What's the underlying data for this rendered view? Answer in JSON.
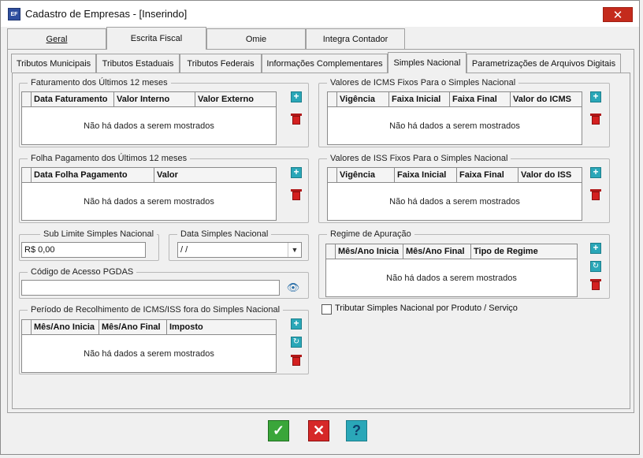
{
  "window": {
    "app_icon": "EF",
    "title": "Cadastro de Empresas - [Inserindo]",
    "close_label": "✕"
  },
  "tabs_main": [
    "Geral",
    "Escrita Fiscal",
    "Omie",
    "Integra Contador"
  ],
  "tabs_main_active": "Escrita Fiscal",
  "tabs_sub": [
    "Tributos Municipais",
    "Tributos Estaduais",
    "Tributos Federais",
    "Informações Complementares",
    "Simples Nacional",
    "Parametrizações de Arquivos Digitais"
  ],
  "tabs_sub_active": "Simples Nacional",
  "empty_grid_text": "Não há dados a serem mostrados",
  "faturamento": {
    "title": "Faturamento dos Últimos 12 meses",
    "columns": [
      "Data Faturamento",
      "Valor Interno",
      "Valor Externo"
    ]
  },
  "folha": {
    "title": "Folha Pagamento dos Últimos 12 meses",
    "columns": [
      "Data Folha Pagamento",
      "Valor"
    ]
  },
  "icms": {
    "title": "Valores de ICMS Fixos Para o Simples Nacional",
    "columns": [
      "Vigência",
      "Faixa Inicial",
      "Faixa Final",
      "Valor do ICMS"
    ]
  },
  "iss": {
    "title": "Valores de ISS Fixos Para o Simples Nacional",
    "columns": [
      "Vigência",
      "Faixa Inicial",
      "Faixa Final",
      "Valor do ISS"
    ]
  },
  "sublimite": {
    "title": "Sub Limite Simples Nacional",
    "value": "R$ 0,00"
  },
  "data_simples": {
    "title": "Data Simples Nacional",
    "value": " /  /"
  },
  "pgdas": {
    "title": "Código de Acesso PGDAS",
    "value": ""
  },
  "regime": {
    "title": "Regime de Apuração",
    "columns": [
      "Mês/Ano Inicia",
      "Mês/Ano Final",
      "Tipo de Regime"
    ]
  },
  "periodo": {
    "title": "Período de Recolhimento de ICMS/ISS fora do Simples Nacional",
    "columns": [
      "Mês/Ano Inicia",
      "Mês/Ano Final",
      "Imposto"
    ]
  },
  "tributar_checkbox_label": "Tributar Simples Nacional por Produto / Serviço",
  "colors": {
    "confirm": "#3aa63a",
    "cancel": "#d62828",
    "help": "#2aa7b8"
  }
}
